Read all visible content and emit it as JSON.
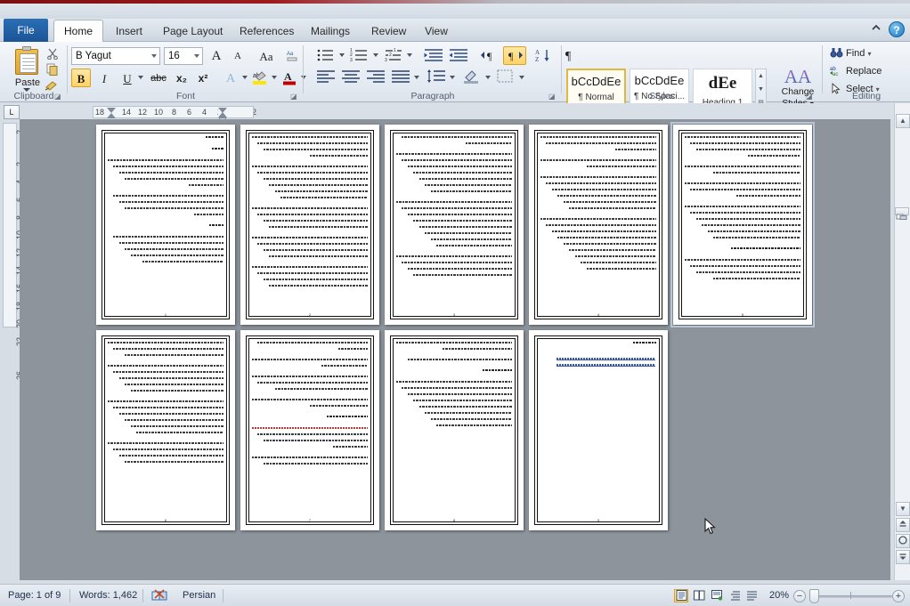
{
  "app": {
    "name": "Microsoft Word 2010"
  },
  "tabs": {
    "file": "File",
    "items": [
      {
        "label": "Home",
        "active": true
      },
      {
        "label": "Insert",
        "active": false
      },
      {
        "label": "Page Layout",
        "active": false
      },
      {
        "label": "References",
        "active": false
      },
      {
        "label": "Mailings",
        "active": false
      },
      {
        "label": "Review",
        "active": false
      },
      {
        "label": "View",
        "active": false
      }
    ],
    "minimize_ribbon_icon": "chevron-up-icon",
    "help_icon": "?"
  },
  "ribbon": {
    "clipboard": {
      "label": "Clipboard",
      "paste_label": "Paste",
      "cut_icon": "scissors-icon",
      "copy_icon": "copy-icon",
      "format_painter_icon": "paintbrush-icon",
      "dialog_launcher": "◪"
    },
    "font": {
      "label": "Font",
      "font_name": "B Yagut",
      "font_size": "16",
      "grow_font": "A",
      "shrink_font": "A",
      "change_case": "Aa",
      "clear_formatting": "clear-formatting-icon",
      "bold": "B",
      "bold_active": true,
      "italic": "I",
      "underline": "U",
      "strikethrough": "abc",
      "subscript": "x₂",
      "superscript": "x²",
      "text_effects": "A",
      "highlight": "ab",
      "font_color": "A",
      "dialog_launcher": "◪"
    },
    "paragraph": {
      "label": "Paragraph",
      "bullets": "bullets-icon",
      "numbering": "numbering-icon",
      "multilevel": "multilevel-list-icon",
      "decrease_indent": "decrease-indent-icon",
      "increase_indent": "increase-indent-icon",
      "ltr": "ltr-text-direction-icon",
      "rtl": "rtl-text-direction-icon",
      "rtl_active": true,
      "sort": "sort-az-icon",
      "show_marks": "¶",
      "align_left": "align-left-icon",
      "align_center": "align-center-icon",
      "align_right": "align-right-icon",
      "justify": "justify-icon",
      "line_spacing": "line-spacing-icon",
      "shading": "shading-icon",
      "borders": "borders-icon",
      "dialog_launcher": "◪"
    },
    "styles": {
      "label": "Styles",
      "gallery": [
        {
          "sample": "bCcDdEe",
          "name": "¶ Normal",
          "selected": true,
          "heading": false
        },
        {
          "sample": "bCcDdEe",
          "name": "¶ No Spaci...",
          "selected": false,
          "heading": false
        },
        {
          "sample": "dEe",
          "name": "Heading 1",
          "selected": false,
          "heading": true
        }
      ],
      "scroll_up": "▲",
      "scroll_down": "▼",
      "more": "▤",
      "change_styles": {
        "line1": "Change",
        "line2": "Styles",
        "icon": "double-a-icon"
      },
      "dialog_launcher": "◪"
    },
    "editing": {
      "label": "Editing",
      "items": [
        {
          "label": "Find",
          "icon": "binoculars-icon",
          "has_arrow": true
        },
        {
          "label": "Replace",
          "icon": "replace-icon",
          "has_arrow": false
        },
        {
          "label": "Select",
          "icon": "pointer-icon",
          "has_arrow": true
        }
      ]
    }
  },
  "ruler": {
    "tab_stop_selector": "L",
    "horizontal_numbers": [
      "18",
      "14",
      "12",
      "10",
      "8",
      "6",
      "4",
      "2",
      "2"
    ],
    "vertical_numbers": [
      "2",
      "2",
      "4",
      "6",
      "8",
      "10",
      "12",
      "14",
      "16",
      "18",
      "20",
      "22",
      "26"
    ]
  },
  "document": {
    "zoom_level": "20%",
    "view_mode": "multiple-pages-thumbnail",
    "language_direction": "rtl",
    "pages": [
      {
        "number": "1",
        "selected": false,
        "lines": [
          6,
          0,
          4,
          0,
          40,
          38,
          36,
          34,
          12,
          0,
          38,
          36,
          34,
          10,
          0,
          5,
          0,
          38,
          36,
          34,
          32,
          28
        ],
        "kinds": [
          "hd",
          "gap",
          "hd",
          "gap",
          "n",
          "n",
          "n",
          "n",
          "n",
          "gap",
          "n",
          "n",
          "n",
          "n",
          "gap",
          "hd",
          "gap",
          "n",
          "n",
          "n",
          "n",
          "n"
        ]
      },
      {
        "number": "2",
        "selected": false,
        "lines": [
          40,
          38,
          36,
          20,
          0,
          40,
          38,
          36,
          34,
          32,
          30,
          0,
          40,
          38,
          36,
          34,
          0,
          40,
          38,
          36,
          34,
          0,
          40,
          38,
          36,
          34
        ],
        "kinds": [
          "n",
          "n",
          "n",
          "n",
          "gap",
          "n",
          "n",
          "n",
          "n",
          "n",
          "n",
          "gap",
          "n",
          "n",
          "n",
          "n",
          "gap",
          "n",
          "n",
          "n",
          "n",
          "gap",
          "n",
          "n",
          "n",
          "n"
        ]
      },
      {
        "number": "3",
        "selected": false,
        "lines": [
          38,
          16,
          0,
          40,
          38,
          36,
          34,
          32,
          30,
          28,
          0,
          40,
          38,
          36,
          34,
          32,
          30,
          28,
          26,
          0,
          40,
          38,
          36,
          34
        ],
        "kinds": [
          "n",
          "n",
          "gap",
          "n",
          "n",
          "n",
          "n",
          "n",
          "n",
          "n",
          "gap",
          "n",
          "n",
          "n",
          "n",
          "n",
          "n",
          "n",
          "n",
          "gap",
          "n",
          "n",
          "n",
          "n"
        ]
      },
      {
        "number": "4",
        "selected": false,
        "lines": [
          40,
          38,
          14,
          0,
          40,
          24,
          0,
          40,
          38,
          36,
          34,
          32,
          30,
          0,
          40,
          38,
          36,
          34,
          32,
          30,
          28,
          26,
          24
        ],
        "kinds": [
          "n",
          "n",
          "n",
          "gap",
          "n",
          "n",
          "gap",
          "n",
          "n",
          "n",
          "n",
          "n",
          "n",
          "gap",
          "n",
          "n",
          "n",
          "n",
          "n",
          "n",
          "n",
          "n",
          "n"
        ]
      },
      {
        "number": "5",
        "selected": true,
        "lines": [
          40,
          38,
          36,
          18,
          0,
          40,
          30,
          0,
          40,
          38,
          22,
          0,
          40,
          38,
          36,
          34,
          32,
          30,
          0,
          24,
          0,
          40,
          38,
          36,
          30
        ],
        "kinds": [
          "n",
          "n",
          "n",
          "n",
          "gap",
          "n",
          "n",
          "gap",
          "n",
          "n",
          "n",
          "gap",
          "n",
          "n",
          "n",
          "n",
          "n",
          "n",
          "gap",
          "hd",
          "gap",
          "n",
          "n",
          "n",
          "n"
        ]
      },
      {
        "number": "6",
        "selected": false,
        "lines": [
          40,
          38,
          34,
          0,
          40,
          38,
          36,
          34,
          32,
          0,
          40,
          38,
          36,
          34,
          32,
          30,
          0,
          40,
          38,
          36,
          34
        ],
        "kinds": [
          "n",
          "n",
          "n",
          "gap",
          "n",
          "n",
          "n",
          "n",
          "n",
          "gap",
          "n",
          "n",
          "n",
          "n",
          "n",
          "n",
          "gap",
          "n",
          "n",
          "n",
          "n"
        ]
      },
      {
        "number": "7",
        "selected": false,
        "lines": [
          38,
          10,
          0,
          40,
          16,
          0,
          40,
          38,
          32,
          0,
          40,
          20,
          0,
          14,
          0,
          40,
          38,
          36,
          12,
          0,
          40,
          36
        ],
        "kinds": [
          "n",
          "n",
          "gap",
          "n",
          "n",
          "gap",
          "n",
          "n",
          "n",
          "gap",
          "n",
          "n",
          "gap",
          "hd",
          "gap",
          "red",
          "n",
          "n",
          "n",
          "gap",
          "n",
          "n"
        ]
      },
      {
        "number": "8",
        "selected": false,
        "lines": [
          40,
          24,
          0,
          36,
          0,
          10,
          0,
          40,
          38,
          36,
          34,
          32,
          30,
          28,
          26
        ],
        "kinds": [
          "n",
          "n",
          "gap",
          "n",
          "gap",
          "hd",
          "gap",
          "n",
          "n",
          "n",
          "n",
          "n",
          "n",
          "n",
          "n"
        ]
      },
      {
        "number": "9",
        "selected": false,
        "lines": [
          8,
          0,
          0,
          34,
          34
        ],
        "kinds": [
          "hd",
          "gap",
          "gap",
          "lnk",
          "lnk"
        ]
      }
    ]
  },
  "status_bar": {
    "page_info": "Page: 1 of 9",
    "word_count": "Words: 1,462",
    "proofing_icon": "spelling-check-icon",
    "language": "Persian",
    "view_buttons": [
      {
        "name": "print-layout",
        "icon": "▤",
        "active": true
      },
      {
        "name": "full-screen-reading",
        "icon": "▥",
        "active": false
      },
      {
        "name": "web-layout",
        "icon": "▦",
        "active": false
      },
      {
        "name": "outline",
        "icon": "▧",
        "active": false
      },
      {
        "name": "draft",
        "icon": "▨",
        "active": false
      }
    ],
    "zoom_out": "−",
    "zoom_in": "+",
    "zoom_value": "20%"
  },
  "scrollbar": {
    "split_icon": "split-window-icon",
    "up_arrow": "▲",
    "down_arrow": "▼",
    "previous_page": "≛",
    "select_browse_object": "◯",
    "next_page": "≛"
  }
}
